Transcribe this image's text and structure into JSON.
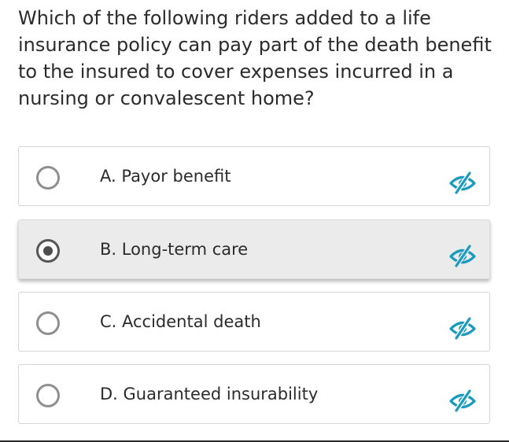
{
  "question": {
    "text": "Which of the following riders added to a life insurance policy can pay part of the death benefit to the insured to cover expenses incurred in a nursing or convalescent home?"
  },
  "options": [
    {
      "label": "A. Payor benefit",
      "selected": false
    },
    {
      "label": "B. Long-term care",
      "selected": true
    },
    {
      "label": "C. Accidental death",
      "selected": false
    },
    {
      "label": "D. Guaranteed insurability",
      "selected": false
    }
  ],
  "icons": {
    "radio": "radio-icon",
    "hide_option": "eye-slash-icon"
  },
  "colors": {
    "accent": "#1a9bbd",
    "selected_background": "#ebebeb",
    "text": "#2b2b2b"
  }
}
